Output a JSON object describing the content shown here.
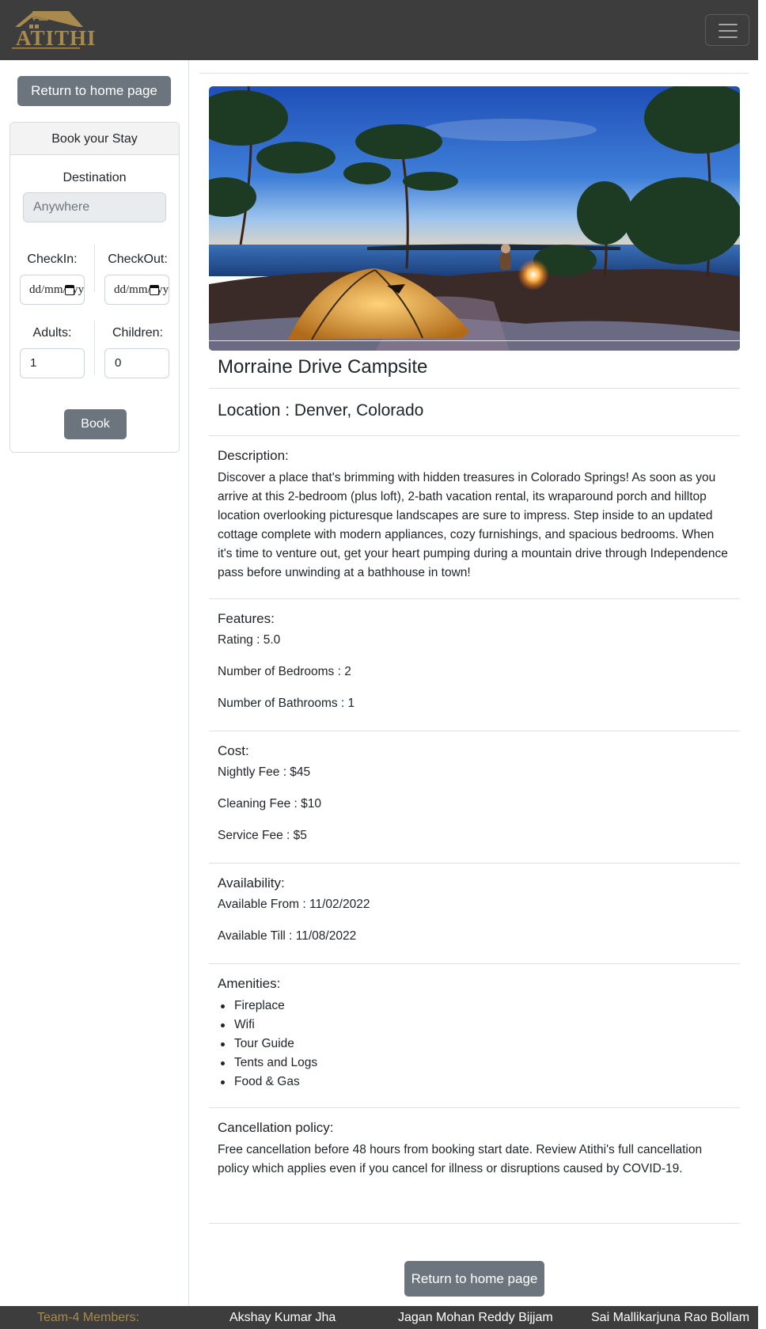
{
  "navbar": {
    "logo_text": "ATITHI",
    "menu_icon": "hamburger-menu-icon"
  },
  "sidebar": {
    "return_button": "Return to home page",
    "booking": {
      "header": "Book your Stay",
      "destination_label": "Destination",
      "destination_placeholder": "Anywhere",
      "checkin_label": "CheckIn:",
      "checkout_label": "CheckOut:",
      "checkin_value": "dd/mm/yyyy",
      "checkout_value": "dd/mm/yyyy",
      "adults_label": "Adults:",
      "children_label": "Children:",
      "adults_value": "1",
      "children_value": "0",
      "book_button": "Book"
    }
  },
  "listing": {
    "name": "Morraine Drive Campsite",
    "location": "Location : Denver, Colorado",
    "description_title": "Description:",
    "description": "Discover a place that's brimming with hidden treasures in Colorado Springs! As soon as you arrive at this 2-bedroom (plus loft), 2-bath vacation rental, its wraparound porch and hilltop location overlooking picturesque landscapes are sure to impress. Step inside to an updated cottage complete with modern appliances, cozy furnishings, and spacious bedrooms. When it's time to venture out, get your heart pumping during a mountain drive through Independence pass before unwinding at a bathhouse in town!",
    "features_title": "Features:",
    "features": [
      "Rating : 5.0",
      "Number of Bedrooms : 2",
      "Number of Bathrooms : 1"
    ],
    "cost_title": "Cost:",
    "cost": [
      "Nightly Fee : $45",
      "Cleaning Fee : $10",
      "Service Fee : $5"
    ],
    "availability_title": "Availability:",
    "availability": [
      "Available From : 11/02/2022",
      "Available Till : 11/08/2022"
    ],
    "amenities_title": "Amenities:",
    "amenities": [
      "Fireplace",
      "Wifi",
      "Tour Guide",
      "Tents and Logs",
      "Food & Gas"
    ],
    "cancellation_title": "Cancellation policy:",
    "cancellation": "Free cancellation before 48 hours from booking start date. Review Atithi's full cancellation policy which applies even if you cancel for illness or disruptions caused by COVID-19.",
    "return_button": "Return to home page"
  },
  "footer": {
    "label": "Team-4 Members:",
    "members": [
      "Akshay Kumar Jha",
      "Jagan Mohan Reddy Bijjam",
      "Sai Mallikarjuna Rao Bollam"
    ]
  },
  "colors": {
    "navbar_bg": "#3d3d3d",
    "brand_gold": "#a88a4e",
    "button_gray": "#6c757d"
  }
}
